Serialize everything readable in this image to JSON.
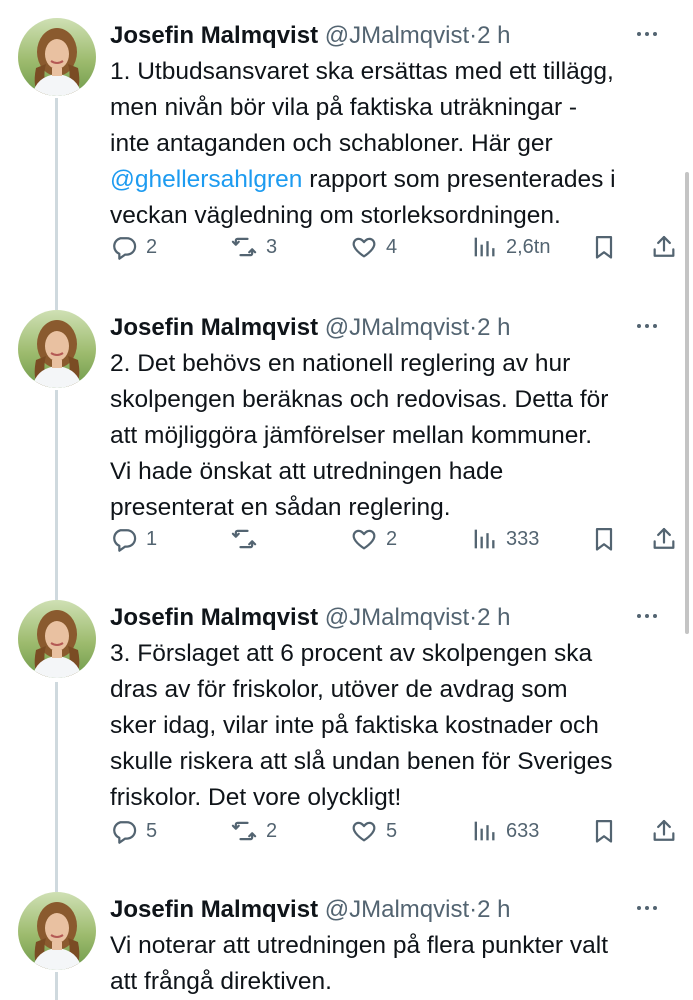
{
  "tweets": [
    {
      "name": "Josefin Malmqvist",
      "handle": "@JMalmqvist",
      "dot": "·",
      "time": "2 h",
      "lines": [
        "1. Utbudsansvaret ska ersättas med ett tillägg,",
        "men nivån bör vila på faktiska uträkningar -",
        "inte antaganden och schabloner. Här ger",
        "",
        "veckan vägledning om storleksordningen."
      ],
      "mention": "@ghellersahlgren",
      "mention_after": " rapport som presenterades i",
      "replies": "2",
      "retweets": "3",
      "likes": "4",
      "views": "2,6tn"
    },
    {
      "name": "Josefin Malmqvist",
      "handle": "@JMalmqvist",
      "dot": "·",
      "time": "2 h",
      "lines": [
        "2. Det behövs en nationell reglering av hur",
        "skolpengen beräknas och redovisas. Detta för",
        "att möjliggöra jämförelser mellan kommuner.",
        "Vi hade önskat att utredningen hade",
        "presenterat en sådan reglering."
      ],
      "replies": "1",
      "retweets": "",
      "likes": "2",
      "views": "333"
    },
    {
      "name": "Josefin Malmqvist",
      "handle": "@JMalmqvist",
      "dot": "·",
      "time": "2 h",
      "lines": [
        "3. Förslaget att 6 procent av skolpengen ska",
        "dras av för friskolor, utöver de avdrag som",
        "sker idag, vilar inte på faktiska kostnader och",
        "skulle riskera att slå undan benen för Sveriges",
        "friskolor. Det vore olyckligt!"
      ],
      "replies": "5",
      "retweets": "2",
      "likes": "5",
      "views": "633"
    },
    {
      "name": "Josefin Malmqvist",
      "handle": "@JMalmqvist",
      "dot": "·",
      "time": "2 h",
      "lines": [
        "Vi noterar att utredningen på flera punkter valt",
        "att frångå direktiven."
      ]
    }
  ],
  "icons": {
    "reply": "reply-icon",
    "retweet": "retweet-icon",
    "like": "heart-icon",
    "views": "views-icon",
    "bookmark": "bookmark-icon",
    "share": "share-icon",
    "more": "more-icon"
  },
  "colors": {
    "text": "#0f1419",
    "secondary": "#536471",
    "link": "#1d9bf0",
    "thread": "#cfd9de"
  }
}
